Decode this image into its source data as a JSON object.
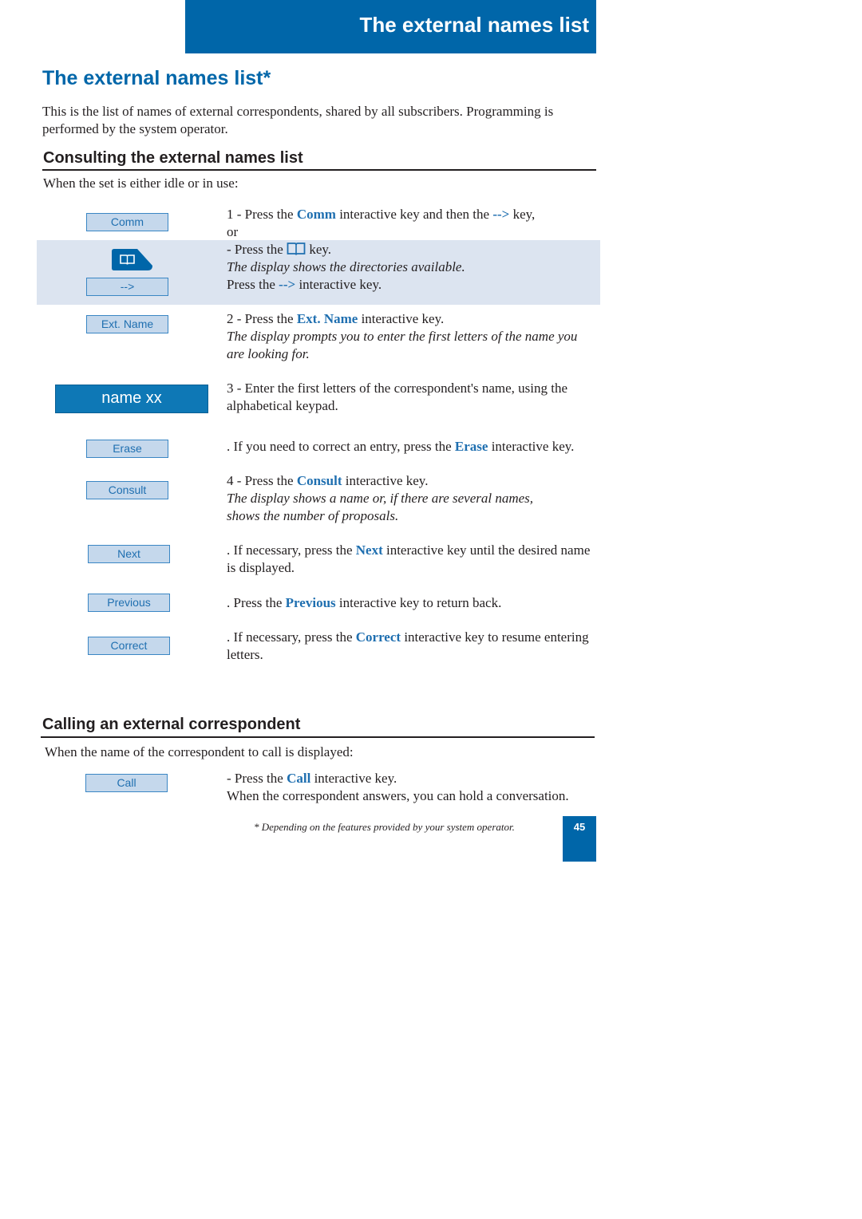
{
  "header": {
    "title": "The external names list"
  },
  "page_title": "The external names list*",
  "intro": "This is the list of names of external correspondents, shared by all subscribers. Programming is performed by the system operator.",
  "colors": {
    "brand_blue": "#0066a9",
    "key_fill": "#c5d8ec",
    "key_text": "#1f6fb0",
    "highlight": "#dce4f0"
  },
  "consulting": {
    "heading": "Consulting the external names list",
    "condition": "When the set is either idle or in use:",
    "keys": {
      "comm": "Comm",
      "arrow": "-->",
      "book_icon": "book-icon",
      "ext_name": "Ext. Name",
      "display": "name xx",
      "erase": "Erase",
      "consult": "Consult",
      "next": "Next",
      "previous": "Previous",
      "correct": "Correct"
    },
    "steps": {
      "s1": {
        "a": "1 - Press the ",
        "kw1": "Comm",
        "b": " interactive key and then the ",
        "kw2": "-->",
        "c": " key,",
        "or": "or"
      },
      "s1b": {
        "a": "- Press the ",
        "b": " key.",
        "italic": "The display shows the directories available.",
        "c": "Press the ",
        "kw": "-->",
        "d": " interactive key."
      },
      "s2": {
        "a": "2 - Press the ",
        "kw": "Ext. Name",
        "b": " interactive key.",
        "italic": "The display prompts you to enter the first letters of the name you are looking for."
      },
      "s3": {
        "text": "3 - Enter the first letters of the correspondent's name, using the alphabetical keypad."
      },
      "erase": {
        "a": ". If you need to correct an entry, press the ",
        "kw": "Erase",
        "b": " interactive key."
      },
      "s4": {
        "a": "4 - Press the ",
        "kw": "Consult",
        "b": " interactive key.",
        "italic": "The display shows a name or, if there are several names, shows the number of proposals."
      },
      "next": {
        "a": ". If necessary, press the ",
        "kw": "Next",
        "b": " interactive key until the desired name is displayed."
      },
      "previous": {
        "a": ". Press the ",
        "kw": "Previous",
        "b": " interactive key to return back."
      },
      "correct": {
        "a": ". If necessary, press the ",
        "kw": "Correct",
        "b": " interactive key to resume entering letters."
      }
    }
  },
  "calling": {
    "heading": "Calling an external correspondent",
    "condition": "When the name of the correspondent to call is displayed:",
    "key": "Call",
    "step": {
      "a": "- Press the ",
      "kw": "Call",
      "b": " interactive key.",
      "c": "When the correspondent answers, you can hold a conversation."
    }
  },
  "footnote": "* Depending on the features provided by your system operator.",
  "page_number": "45"
}
